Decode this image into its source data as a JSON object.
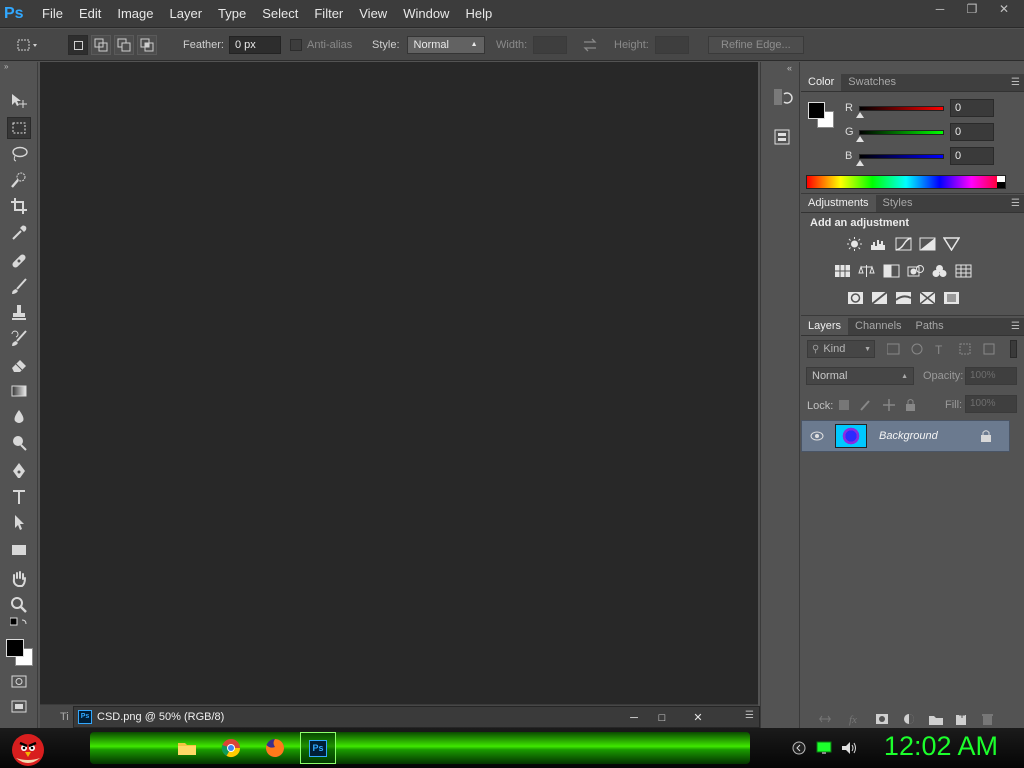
{
  "app": {
    "logo_text": "Ps"
  },
  "menubar": {
    "items": [
      "File",
      "Edit",
      "Image",
      "Layer",
      "Type",
      "Select",
      "Filter",
      "View",
      "Window",
      "Help"
    ]
  },
  "options": {
    "feather_label": "Feather:",
    "feather_value": "0 px",
    "antialias_label": "Anti-alias",
    "style_label": "Style:",
    "style_value": "Normal",
    "width_label": "Width:",
    "height_label": "Height:",
    "refine_label": "Refine Edge..."
  },
  "document": {
    "tab_prefix": "Ti",
    "title": "CSD.png @ 50% (RGB/8)"
  },
  "color_panel": {
    "tabs": [
      "Color",
      "Swatches"
    ],
    "r_label": "R",
    "g_label": "G",
    "b_label": "B",
    "r_value": "0",
    "g_value": "0",
    "b_value": "0",
    "foreground": "#000000",
    "background": "#ffffff"
  },
  "adjustments_panel": {
    "tabs": [
      "Adjustments",
      "Styles"
    ],
    "title": "Add an adjustment"
  },
  "layers_panel": {
    "tabs": [
      "Layers",
      "Channels",
      "Paths"
    ],
    "filter_kind": "Kind",
    "blend_mode": "Normal",
    "opacity_label": "Opacity:",
    "opacity_value": "100%",
    "lock_label": "Lock:",
    "fill_label": "Fill:",
    "fill_value": "100%",
    "layers": [
      {
        "name": "Background",
        "visible": true,
        "locked": true
      }
    ]
  },
  "taskbar": {
    "clock": "12:02 AM"
  },
  "colors": {
    "accent": "#31a8ff",
    "clock": "#1cff2c",
    "canvas": "#282828"
  }
}
